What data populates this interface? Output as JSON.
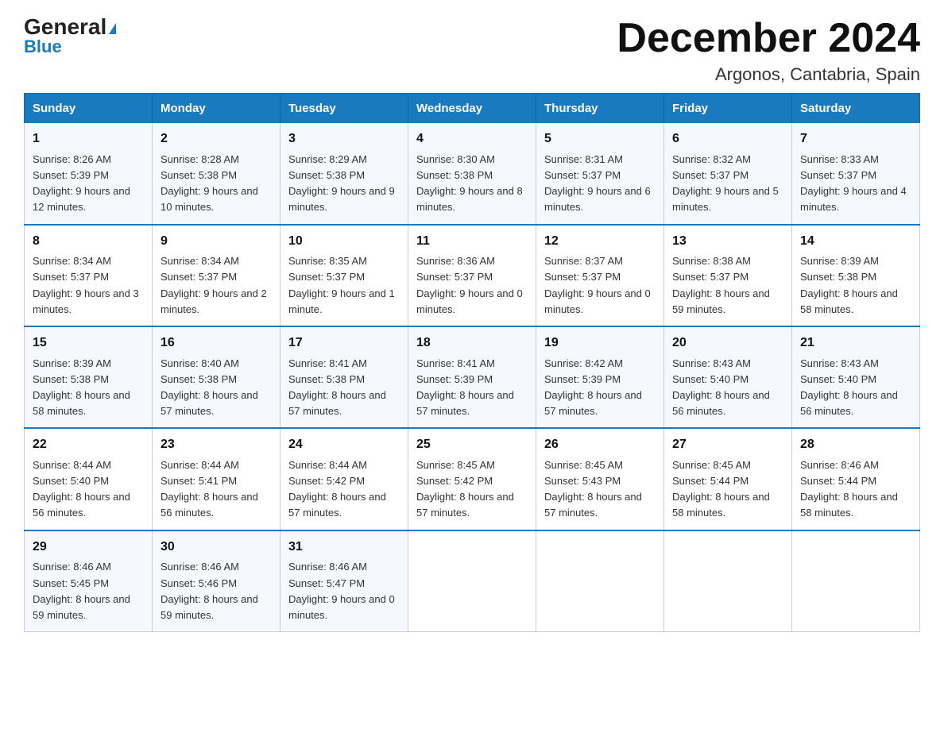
{
  "header": {
    "logo_line1": "General",
    "logo_line2": "Blue",
    "title": "December 2024",
    "subtitle": "Argonos, Cantabria, Spain"
  },
  "days_of_week": [
    "Sunday",
    "Monday",
    "Tuesday",
    "Wednesday",
    "Thursday",
    "Friday",
    "Saturday"
  ],
  "weeks": [
    [
      {
        "day": "1",
        "sunrise": "8:26 AM",
        "sunset": "5:39 PM",
        "daylight": "9 hours and 12 minutes."
      },
      {
        "day": "2",
        "sunrise": "8:28 AM",
        "sunset": "5:38 PM",
        "daylight": "9 hours and 10 minutes."
      },
      {
        "day": "3",
        "sunrise": "8:29 AM",
        "sunset": "5:38 PM",
        "daylight": "9 hours and 9 minutes."
      },
      {
        "day": "4",
        "sunrise": "8:30 AM",
        "sunset": "5:38 PM",
        "daylight": "9 hours and 8 minutes."
      },
      {
        "day": "5",
        "sunrise": "8:31 AM",
        "sunset": "5:37 PM",
        "daylight": "9 hours and 6 minutes."
      },
      {
        "day": "6",
        "sunrise": "8:32 AM",
        "sunset": "5:37 PM",
        "daylight": "9 hours and 5 minutes."
      },
      {
        "day": "7",
        "sunrise": "8:33 AM",
        "sunset": "5:37 PM",
        "daylight": "9 hours and 4 minutes."
      }
    ],
    [
      {
        "day": "8",
        "sunrise": "8:34 AM",
        "sunset": "5:37 PM",
        "daylight": "9 hours and 3 minutes."
      },
      {
        "day": "9",
        "sunrise": "8:34 AM",
        "sunset": "5:37 PM",
        "daylight": "9 hours and 2 minutes."
      },
      {
        "day": "10",
        "sunrise": "8:35 AM",
        "sunset": "5:37 PM",
        "daylight": "9 hours and 1 minute."
      },
      {
        "day": "11",
        "sunrise": "8:36 AM",
        "sunset": "5:37 PM",
        "daylight": "9 hours and 0 minutes."
      },
      {
        "day": "12",
        "sunrise": "8:37 AM",
        "sunset": "5:37 PM",
        "daylight": "9 hours and 0 minutes."
      },
      {
        "day": "13",
        "sunrise": "8:38 AM",
        "sunset": "5:37 PM",
        "daylight": "8 hours and 59 minutes."
      },
      {
        "day": "14",
        "sunrise": "8:39 AM",
        "sunset": "5:38 PM",
        "daylight": "8 hours and 58 minutes."
      }
    ],
    [
      {
        "day": "15",
        "sunrise": "8:39 AM",
        "sunset": "5:38 PM",
        "daylight": "8 hours and 58 minutes."
      },
      {
        "day": "16",
        "sunrise": "8:40 AM",
        "sunset": "5:38 PM",
        "daylight": "8 hours and 57 minutes."
      },
      {
        "day": "17",
        "sunrise": "8:41 AM",
        "sunset": "5:38 PM",
        "daylight": "8 hours and 57 minutes."
      },
      {
        "day": "18",
        "sunrise": "8:41 AM",
        "sunset": "5:39 PM",
        "daylight": "8 hours and 57 minutes."
      },
      {
        "day": "19",
        "sunrise": "8:42 AM",
        "sunset": "5:39 PM",
        "daylight": "8 hours and 57 minutes."
      },
      {
        "day": "20",
        "sunrise": "8:43 AM",
        "sunset": "5:40 PM",
        "daylight": "8 hours and 56 minutes."
      },
      {
        "day": "21",
        "sunrise": "8:43 AM",
        "sunset": "5:40 PM",
        "daylight": "8 hours and 56 minutes."
      }
    ],
    [
      {
        "day": "22",
        "sunrise": "8:44 AM",
        "sunset": "5:40 PM",
        "daylight": "8 hours and 56 minutes."
      },
      {
        "day": "23",
        "sunrise": "8:44 AM",
        "sunset": "5:41 PM",
        "daylight": "8 hours and 56 minutes."
      },
      {
        "day": "24",
        "sunrise": "8:44 AM",
        "sunset": "5:42 PM",
        "daylight": "8 hours and 57 minutes."
      },
      {
        "day": "25",
        "sunrise": "8:45 AM",
        "sunset": "5:42 PM",
        "daylight": "8 hours and 57 minutes."
      },
      {
        "day": "26",
        "sunrise": "8:45 AM",
        "sunset": "5:43 PM",
        "daylight": "8 hours and 57 minutes."
      },
      {
        "day": "27",
        "sunrise": "8:45 AM",
        "sunset": "5:44 PM",
        "daylight": "8 hours and 58 minutes."
      },
      {
        "day": "28",
        "sunrise": "8:46 AM",
        "sunset": "5:44 PM",
        "daylight": "8 hours and 58 minutes."
      }
    ],
    [
      {
        "day": "29",
        "sunrise": "8:46 AM",
        "sunset": "5:45 PM",
        "daylight": "8 hours and 59 minutes."
      },
      {
        "day": "30",
        "sunrise": "8:46 AM",
        "sunset": "5:46 PM",
        "daylight": "8 hours and 59 minutes."
      },
      {
        "day": "31",
        "sunrise": "8:46 AM",
        "sunset": "5:47 PM",
        "daylight": "9 hours and 0 minutes."
      },
      null,
      null,
      null,
      null
    ]
  ]
}
